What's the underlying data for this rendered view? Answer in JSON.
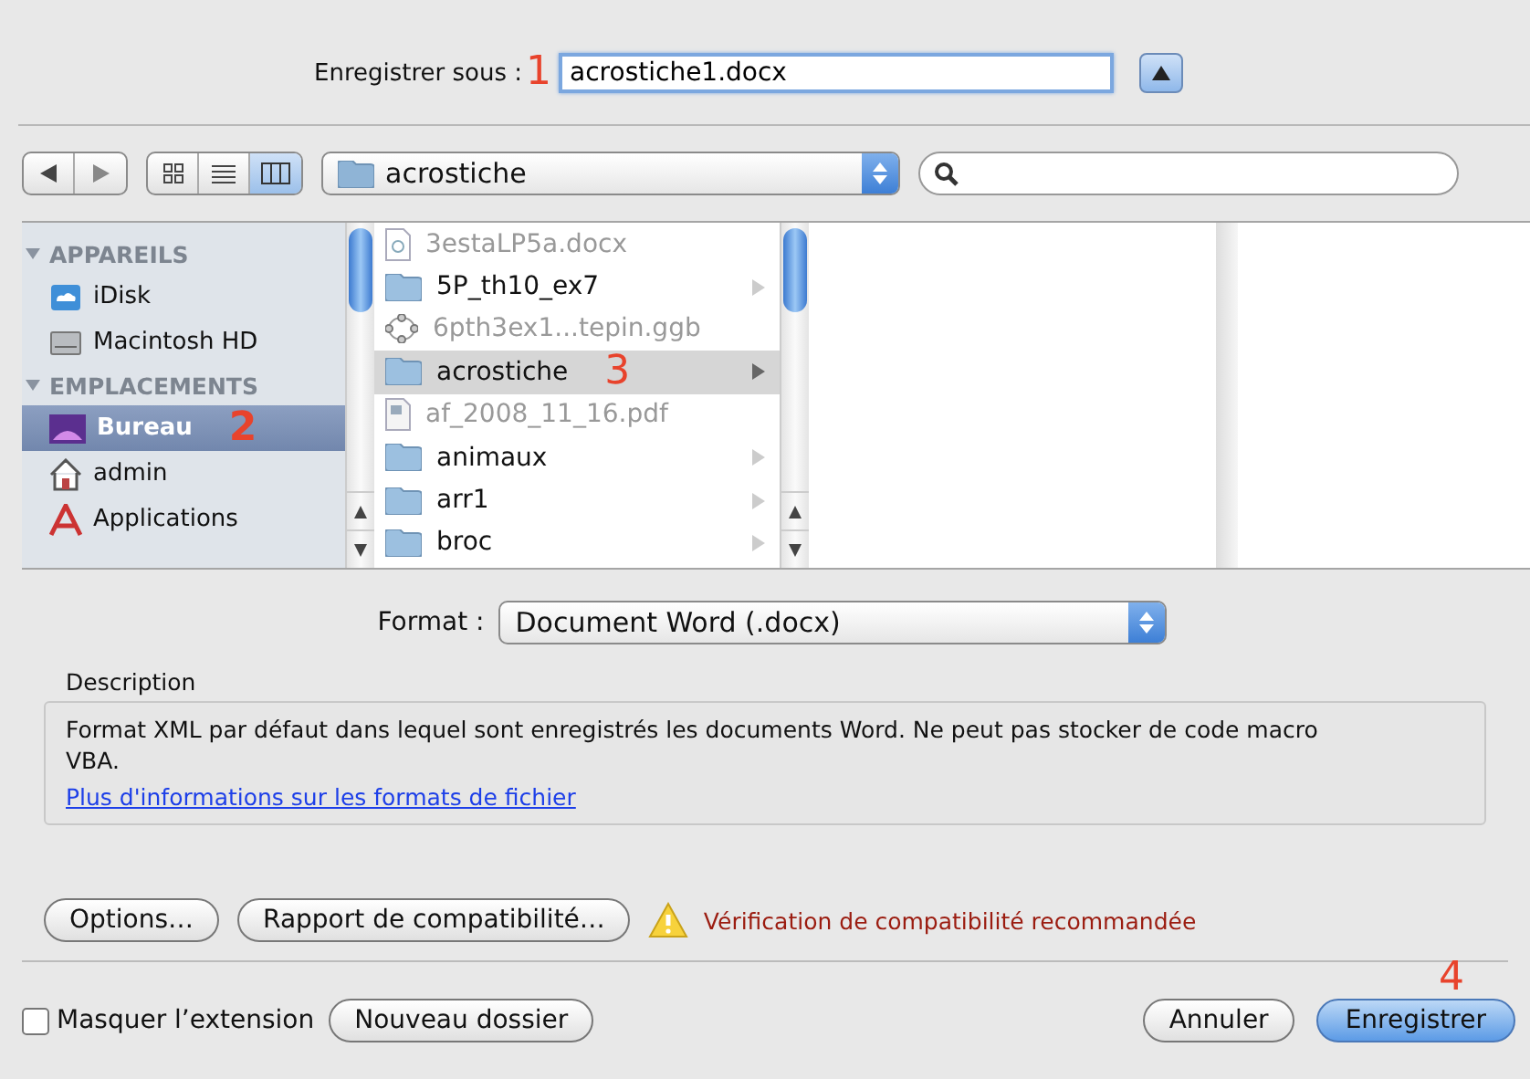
{
  "save_as": {
    "label": "Enregistrer sous :",
    "annotation": "1",
    "value": "acrostiche1.docx"
  },
  "toolbar": {
    "views": [
      {
        "kind": "icons",
        "selected": false
      },
      {
        "kind": "list",
        "selected": false
      },
      {
        "kind": "columns",
        "selected": true
      }
    ],
    "location": "acrostiche"
  },
  "sidebar": [
    {
      "title": "APPAREILS",
      "expanded": true,
      "items": [
        {
          "label": "iDisk",
          "kind": "idisk",
          "selected": false
        },
        {
          "label": "Macintosh HD",
          "kind": "disk",
          "selected": false
        }
      ]
    },
    {
      "title": "EMPLACEMENTS",
      "expanded": true,
      "items": [
        {
          "label": "Bureau",
          "kind": "desktop",
          "selected": true,
          "annotation": "2"
        },
        {
          "label": "admin",
          "kind": "home",
          "selected": false
        },
        {
          "label": "Applications",
          "kind": "apps",
          "selected": false
        }
      ]
    }
  ],
  "files": [
    {
      "name": "3estaLP5a.docx",
      "kind": "document",
      "disabled": true,
      "selected": false
    },
    {
      "name": "5P_th10_ex7",
      "kind": "folder",
      "disabled": false,
      "selected": false
    },
    {
      "name": "6pth3ex1...tepin.ggb",
      "kind": "geogebra",
      "disabled": true,
      "selected": false
    },
    {
      "name": "acrostiche",
      "kind": "folder",
      "disabled": false,
      "selected": true,
      "annotation": "3"
    },
    {
      "name": "af_2008_11_16.pdf",
      "kind": "pdf",
      "disabled": true,
      "selected": false
    },
    {
      "name": "animaux",
      "kind": "folder",
      "disabled": false,
      "selected": false
    },
    {
      "name": "arr1",
      "kind": "folder",
      "disabled": false,
      "selected": false
    },
    {
      "name": "broc",
      "kind": "folder",
      "disabled": false,
      "selected": false
    }
  ],
  "format": {
    "label": "Format :",
    "value": "Document Word (.docx)"
  },
  "description": {
    "title": "Description",
    "text": "Format XML par défaut dans lequel sont enregistrés les documents Word. Ne peut pas stocker de code macro VBA.",
    "link": "Plus d'informations sur les formats de fichier"
  },
  "option_buttons": [
    "Options…",
    "Rapport de compatibilité…"
  ],
  "warning": "Vérification de compatibilité recommandée",
  "hide_extension": {
    "label": "Masquer l’extension",
    "checked": false
  },
  "new_folder": "Nouveau dossier",
  "cancel": "Annuler",
  "save": {
    "label": "Enregistrer",
    "annotation": "4"
  }
}
